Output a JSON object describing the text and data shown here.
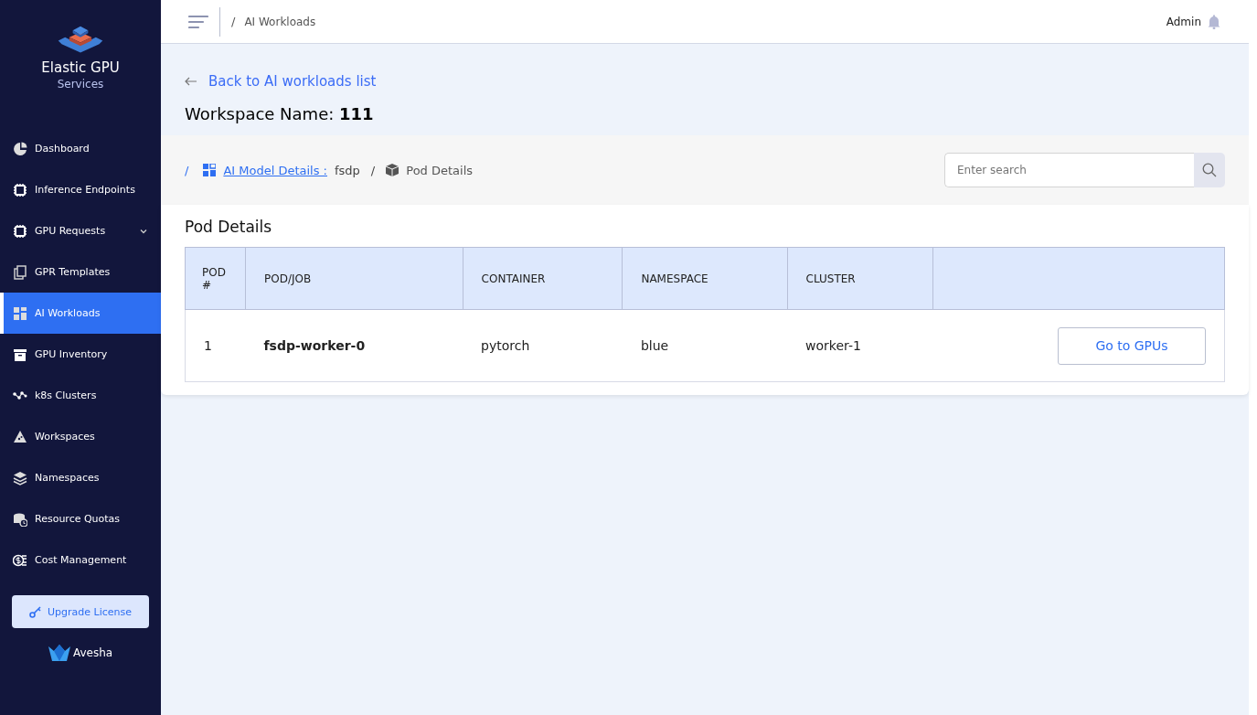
{
  "brand": {
    "title": "Elastic GPU",
    "subtitle": "Services"
  },
  "sidebar": {
    "items": [
      {
        "label": "Dashboard",
        "selected": false
      },
      {
        "label": "Inference Endpoints",
        "selected": false
      },
      {
        "label": "GPU Requests",
        "selected": false,
        "expanded": false
      },
      {
        "label": "GPR Templates",
        "selected": false
      },
      {
        "label": "AI Workloads",
        "selected": true
      },
      {
        "label": "GPU Inventory",
        "selected": false
      },
      {
        "label": "k8s Clusters",
        "selected": false
      },
      {
        "label": "Workspaces",
        "selected": false
      },
      {
        "label": "Namespaces",
        "selected": false
      },
      {
        "label": "Resource Quotas",
        "selected": false
      },
      {
        "label": "Cost Management",
        "selected": false
      }
    ],
    "upgrade_button": "Upgrade License",
    "footer_logo": "Avesha"
  },
  "topbar": {
    "breadcrumb_separator": "/",
    "breadcrumb": "AI Workloads",
    "user": "Admin"
  },
  "back_link": "Back to AI workloads list",
  "workspace_title": "Workspace Name: **111**",
  "breadcrumb": {
    "items": [
      {
        "kind": "separator",
        "text": "/"
      },
      {
        "kind": "link",
        "text": "AI Model Details :"
      },
      {
        "kind": "text",
        "text": "fsdp"
      },
      {
        "kind": "separator",
        "text": "/"
      },
      {
        "kind": "current",
        "text": "Pod Details"
      }
    ]
  },
  "search": {
    "placeholder": "Enter search"
  },
  "card": {
    "title": "Pod Details",
    "table": {
      "columns": [
        "POD #",
        "POD/JOB",
        "CONTAINER",
        "NAMESPACE",
        "CLUSTER"
      ],
      "rows": [
        {
          "cells": [
            "1",
            "fsdp-worker-0",
            "pytorch",
            "blue",
            "worker-1"
          ],
          "action": "Go to GPUs"
        }
      ]
    }
  }
}
